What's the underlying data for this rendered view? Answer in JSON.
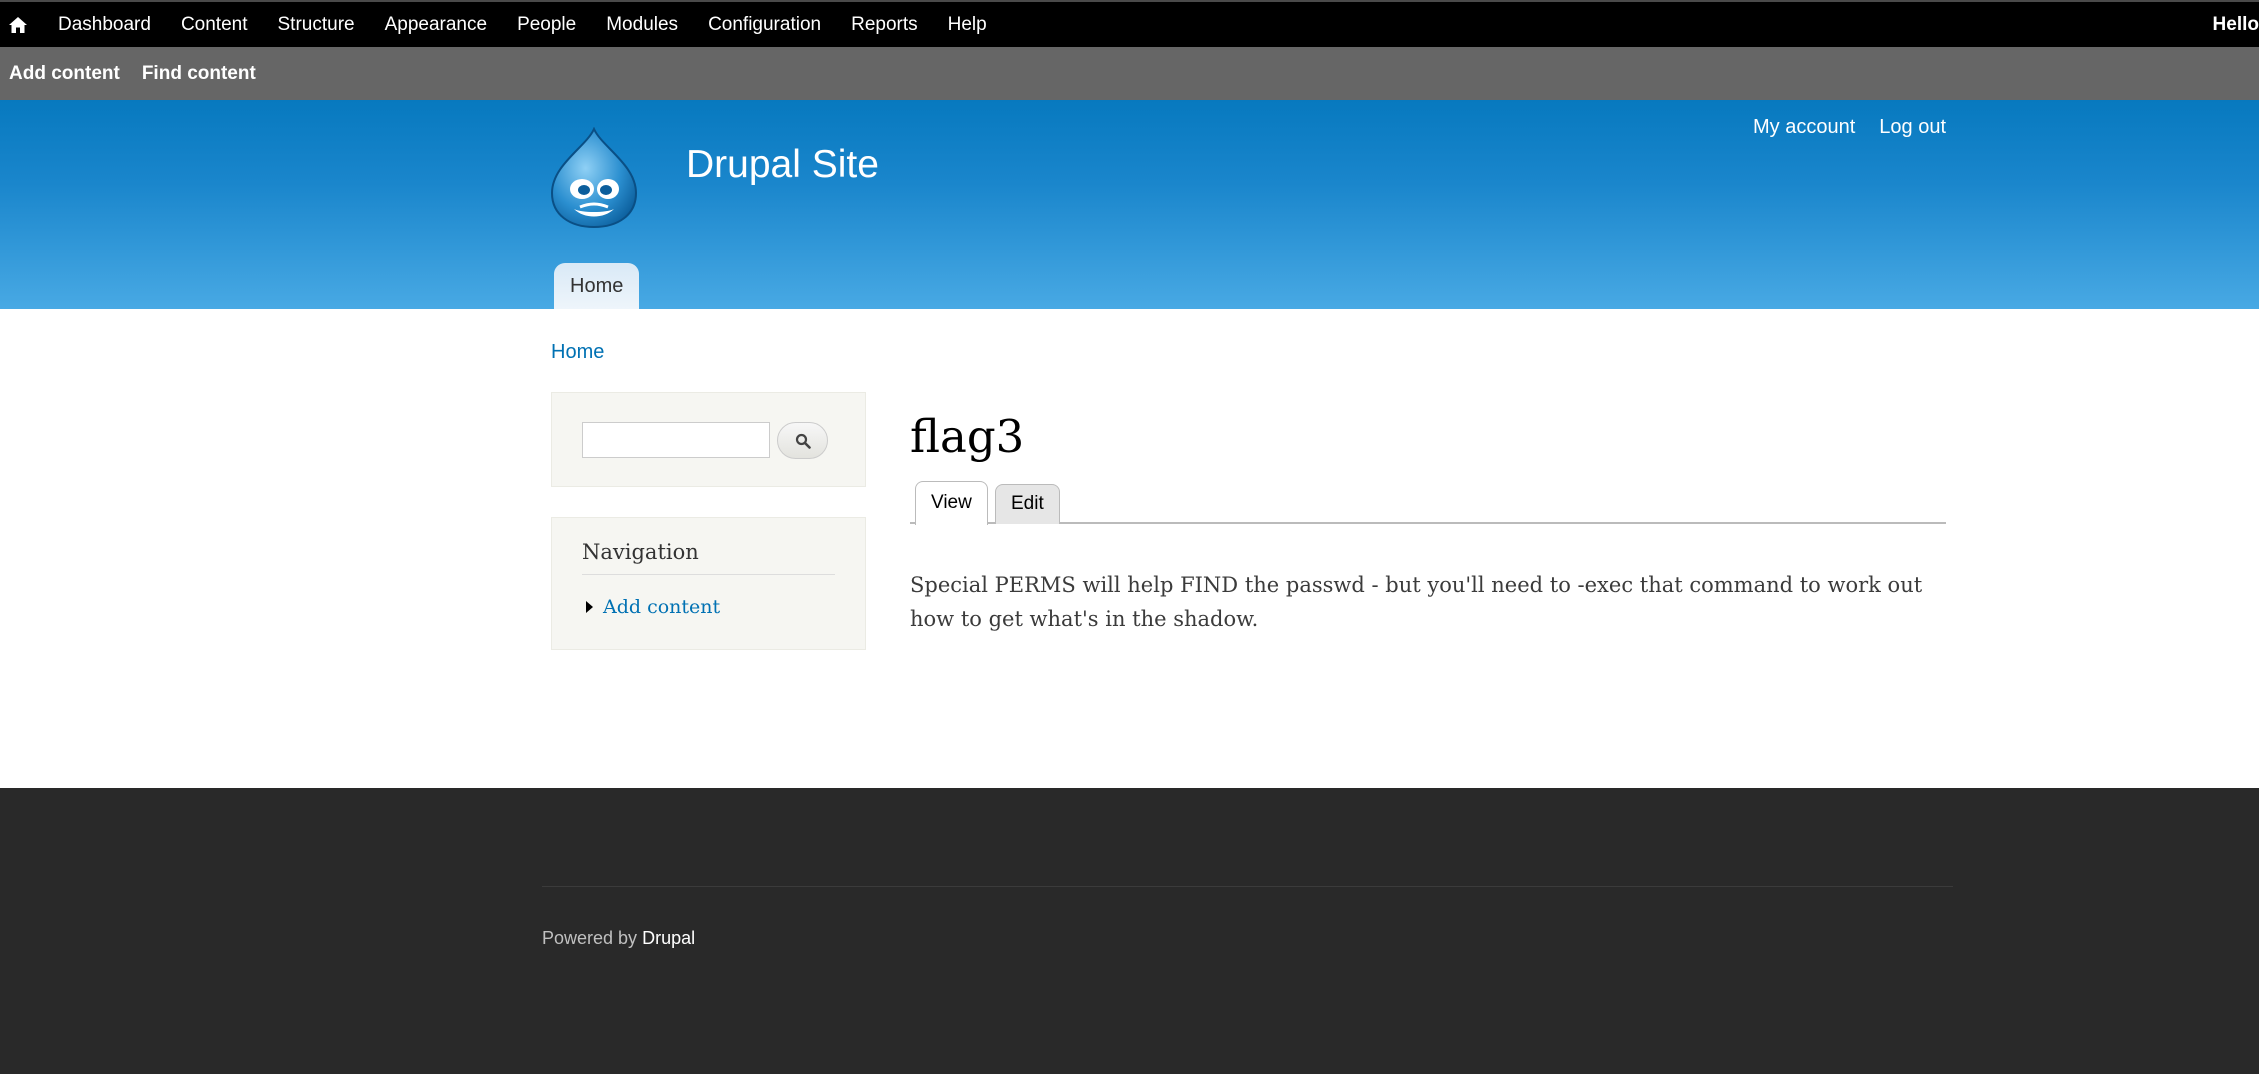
{
  "toolbar": {
    "items": [
      "Dashboard",
      "Content",
      "Structure",
      "Appearance",
      "People",
      "Modules",
      "Configuration",
      "Reports",
      "Help"
    ],
    "greeting": "Hello"
  },
  "shortcuts": {
    "items": [
      "Add content",
      "Find content"
    ]
  },
  "header": {
    "site_name": "Drupal Site",
    "secondary_menu": [
      "My account",
      "Log out"
    ],
    "main_menu": [
      "Home"
    ]
  },
  "breadcrumb": "Home",
  "sidebar": {
    "search": {
      "value": "",
      "placeholder": ""
    },
    "navigation": {
      "title": "Navigation",
      "items": [
        "Add content"
      ]
    }
  },
  "node": {
    "title": "flag3",
    "tabs": [
      "View",
      "Edit"
    ],
    "active_tab": "View",
    "body": "Special PERMS will help FIND the passwd - but you'll need to -exec that command to work out how to get what's in the shadow."
  },
  "footer": {
    "powered_prefix": "Powered by",
    "powered_link": "Drupal"
  },
  "colors": {
    "toolbar": "#000000",
    "shortcuts": "#666666",
    "header_top": "#0779bf",
    "header_bottom": "#48a9e4",
    "link": "#0071b3",
    "footer": "#292929"
  }
}
